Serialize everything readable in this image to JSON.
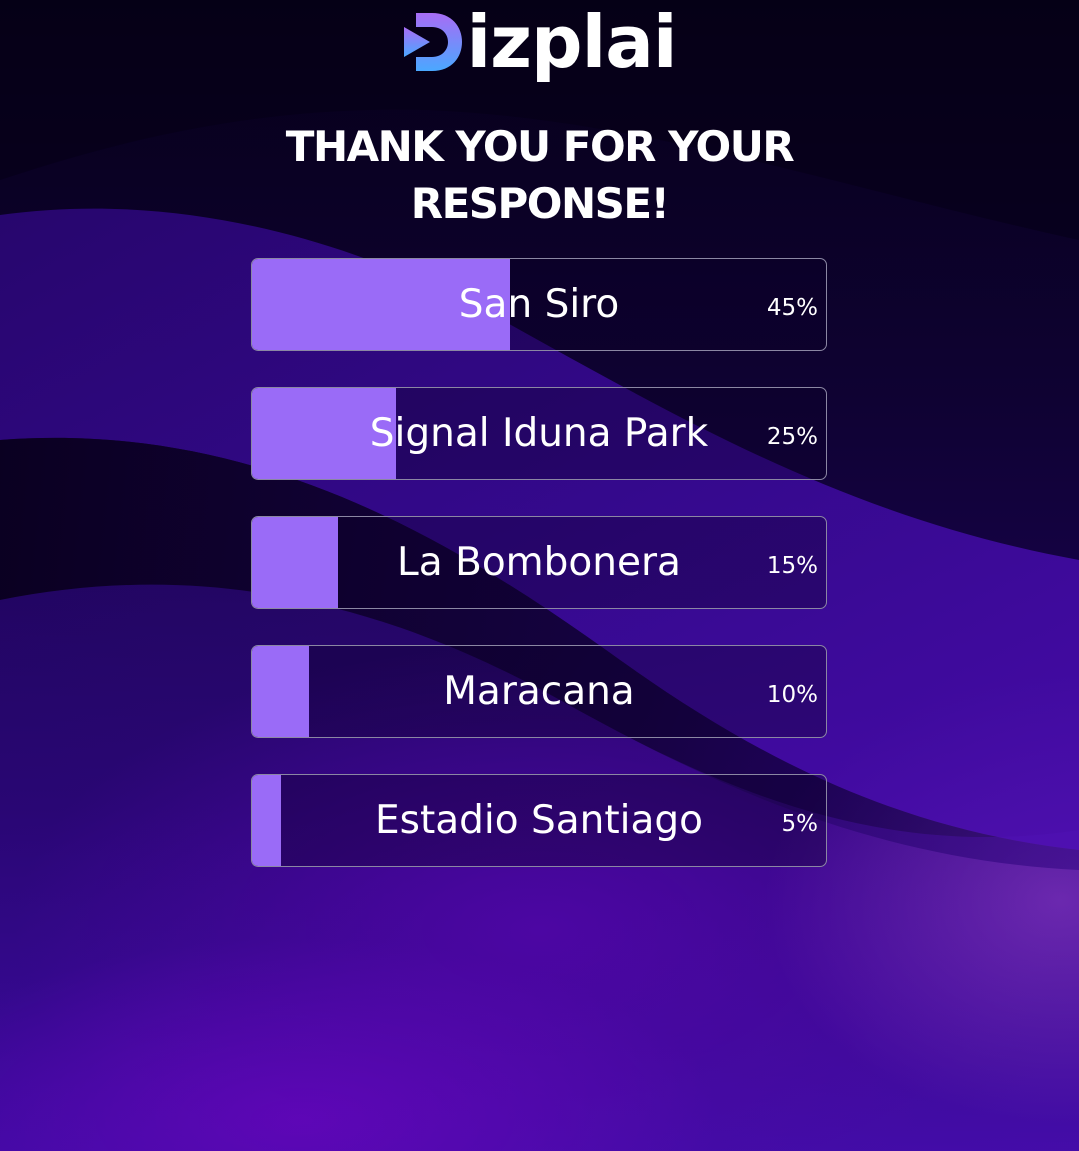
{
  "brand": {
    "name": "Dizplai",
    "logo_icon": "play-icon",
    "logo_text": "izplai",
    "accent": "#9a6bf7"
  },
  "title": {
    "line1": "THANK YOU FOR YOUR",
    "line2": "RESPONSE!"
  },
  "results": [
    {
      "label": "San Siro",
      "percent_text": "45%",
      "value": 45
    },
    {
      "label": "Signal Iduna Park",
      "percent_text": "25%",
      "value": 25
    },
    {
      "label": "La Bombonera",
      "percent_text": "15%",
      "value": 15
    },
    {
      "label": "Maracana",
      "percent_text": "10%",
      "value": 10
    },
    {
      "label": "Estadio Santiago",
      "percent_text": "5%",
      "value": 5
    }
  ]
}
